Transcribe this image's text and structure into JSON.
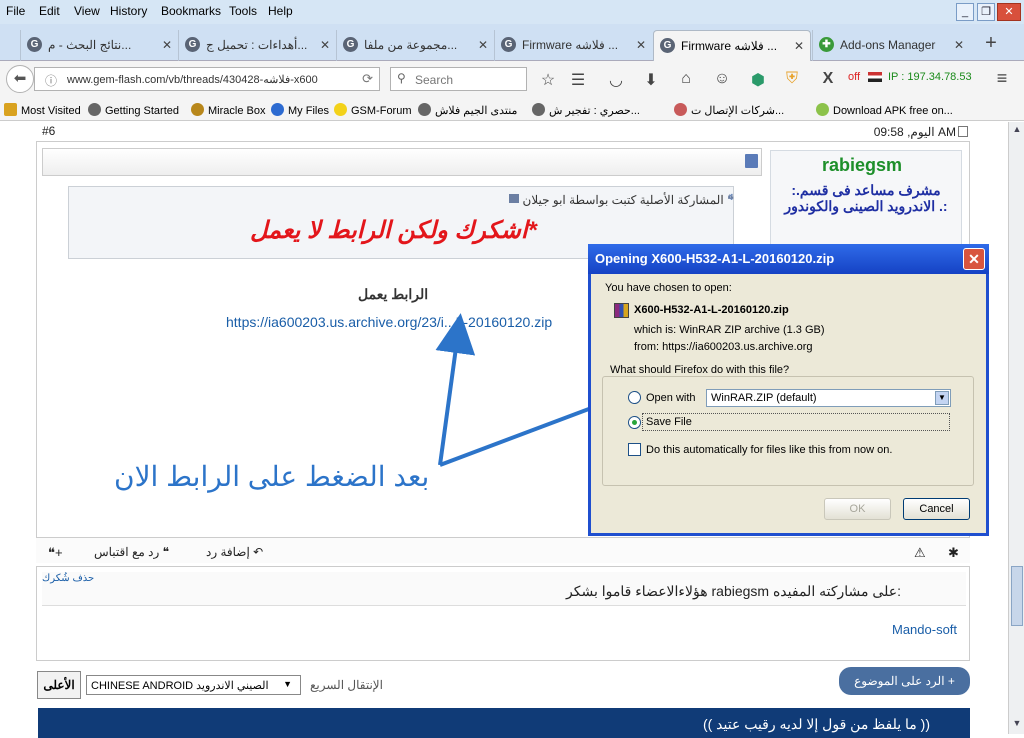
{
  "menubar": {
    "items": [
      "File",
      "Edit",
      "View",
      "History",
      "Bookmarks",
      "Tools",
      "Help"
    ]
  },
  "tabs": [
    {
      "label": "نتائج البحث - م...",
      "icon": "G"
    },
    {
      "label": "أهداءات : تحميل ج...",
      "icon": "G"
    },
    {
      "label": "مجموعة من ملفا...",
      "icon": "G"
    },
    {
      "label": "Firmware فلاشه ...",
      "icon": "G"
    },
    {
      "label": "Firmware فلاشه ...",
      "icon": "G"
    },
    {
      "label": "Add-ons Manager",
      "icon": "✚"
    }
  ],
  "navbar": {
    "url": "www.gem-flash.com/vb/threads/430428-فلاشه-x600",
    "search_placeholder": "Search",
    "status_off": "off",
    "ip": "IP : 197.34.78.53"
  },
  "bookmarks": [
    "Most Visited",
    "Getting Started",
    "Miracle Box",
    "My Files",
    "GSM-Forum",
    "منتدى الجيم فلاش",
    "حصري : تفجير ش...",
    "شركات الإتصال ت...",
    "Download APK free on..."
  ],
  "post": {
    "number": "#6",
    "time": "اليوم, 09:58 AM",
    "quote_title": "المشاركة الأصلية كتبت بواسطة ابو جيلان",
    "quote_text": "اشكرك ولكن الرابط لا يعمل*",
    "link_title": "الرابط يعمل",
    "link_url": "https://ia600203.us.archive.org/23/i...L-20160120.zip",
    "annotation": "بعد الضغط على الرابط الان",
    "username": "rabiegsm",
    "user_title": ":.مشرف مساعد فى قسم الاندرويد الصينى والكوندور .:",
    "action_reply": "إضافة رد",
    "action_quote_reply": "رد مع اقتباس"
  },
  "thanks": {
    "remove": "حذف شُكرك",
    "text": "هؤلاءالاعضاء قاموا بشكر rabiegsm على مشاركته المفيده:",
    "user": "Mando-soft"
  },
  "footer": {
    "top_button": "الأعلى",
    "jump_value": "CHINESE ANDROID الصيني الاندرويد",
    "jump_label": "الإنتقال السريع",
    "reply_button": "الرد على الموضوع",
    "banner": "(( ما يلفظ من قول إلا لديه رقيب عتيد ))"
  },
  "dialog": {
    "title": "Opening X600-H532-A1-L-20160120.zip",
    "chosen": "You have chosen to open:",
    "filename": "X600-H532-A1-L-20160120.zip",
    "which_is": "which is:  WinRAR ZIP archive (1.3 GB)",
    "from": "from:  https://ia600203.us.archive.org",
    "question": "What should Firefox do with this file?",
    "open_with": "Open with",
    "open_with_value": "WinRAR.ZIP (default)",
    "save_file": "Save File",
    "auto": "Do this automatically for files like this from now on.",
    "ok": "OK",
    "cancel": "Cancel"
  },
  "colors": {
    "accent": "#1f4fcf",
    "annotation": "#2c74c9",
    "quote": "#e3161b",
    "username": "#1d8f2a"
  }
}
